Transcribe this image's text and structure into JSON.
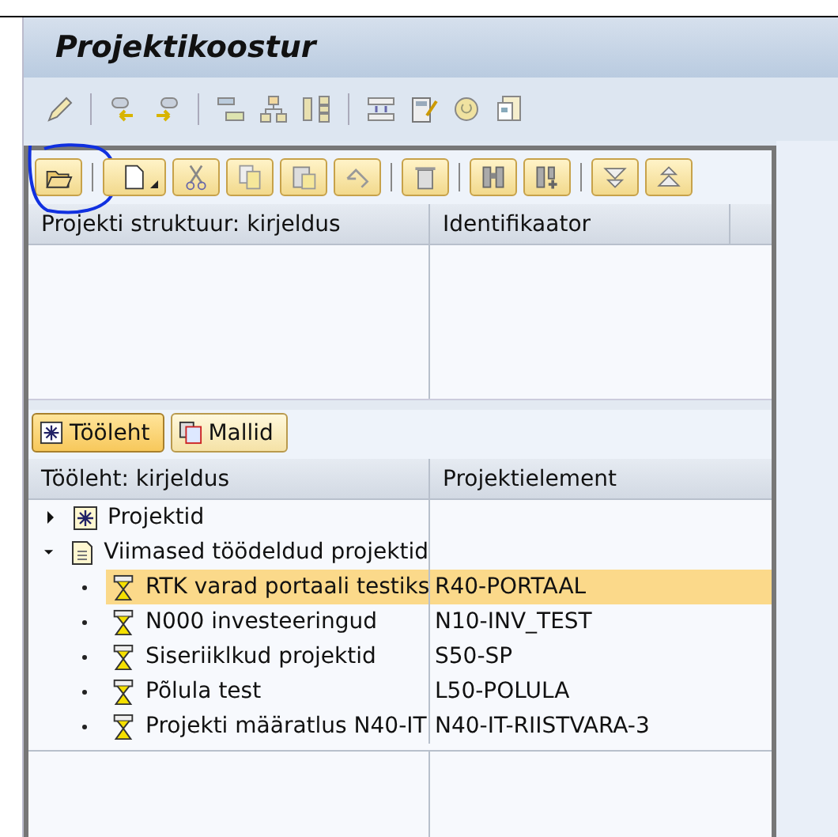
{
  "window": {
    "title": "Projektikoostur"
  },
  "structure_table": {
    "columns": [
      "Projekti struktuur: kirjeldus",
      "Identifikaator"
    ]
  },
  "tabs": [
    {
      "label": "Tööleht",
      "selected": true
    },
    {
      "label": "Mallid",
      "selected": false
    }
  ],
  "worklist": {
    "columns": [
      "Tööleht: kirjeldus",
      "Projektielement"
    ],
    "items": [
      {
        "kind": "folder",
        "label": "Projektid",
        "expanded": false
      },
      {
        "kind": "list",
        "label": "Viimased töödeldud projektid",
        "expanded": true,
        "children": [
          {
            "label": "RTK varad portaali testiks",
            "element": "R40-PORTAAL",
            "selected": true
          },
          {
            "label": "N000 investeeringud",
            "element": "N10-INV_TEST",
            "selected": false
          },
          {
            "label": "Siseriiklkud projektid",
            "element": "S50-SP",
            "selected": false
          },
          {
            "label": "Põlula test",
            "element": "L50-POLULA",
            "selected": false
          },
          {
            "label": "Projekti määratlus N40-IT",
            "element": "N40-IT-RIISTVARA-3",
            "selected": false
          }
        ]
      }
    ]
  }
}
